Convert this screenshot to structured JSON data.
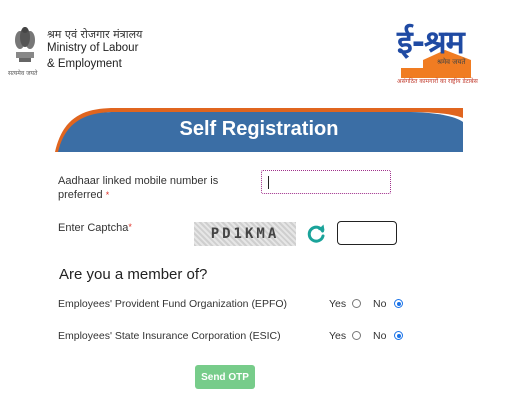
{
  "header": {
    "ministry_hindi": "श्रम एवं रोजगार मंत्रालय",
    "ministry_line1": "Ministry of Labour",
    "ministry_line2": "& Employment",
    "emblem_motto": "सत्यमेव जयते",
    "logo_text": "ई-श्रम",
    "logo_motto": "श्रमेव जयते",
    "logo_subtitle": "असंगठित कामगारों का राष्ट्रीय डेटाबेस"
  },
  "banner": {
    "title": "Self Registration"
  },
  "form": {
    "mobile_label": "Aadhaar linked mobile number is preferred",
    "mobile_value": "",
    "captcha_label": "Enter Captcha",
    "captcha_text": "PD1KMA",
    "captcha_value": "",
    "required_mark": "*",
    "member_heading": "Are you a member of?",
    "questions": [
      {
        "label": "Employees' Provident Fund Organization (EPFO)",
        "yes": "Yes",
        "no": "No",
        "selected": "No"
      },
      {
        "label": "Employees' State Insurance Corporation (ESIC)",
        "yes": "Yes",
        "no": "No",
        "selected": "No"
      }
    ],
    "submit_label": "Send OTP"
  },
  "colors": {
    "banner_blue": "#3b6ea5",
    "banner_orange": "#e0651f",
    "logo_blue": "#1f4aa3",
    "logo_orange": "#f07c22",
    "button_green": "#77cc8a",
    "radio_selected": "#1a73e8"
  },
  "icons": [
    "national-emblem-icon",
    "refresh-icon"
  ]
}
